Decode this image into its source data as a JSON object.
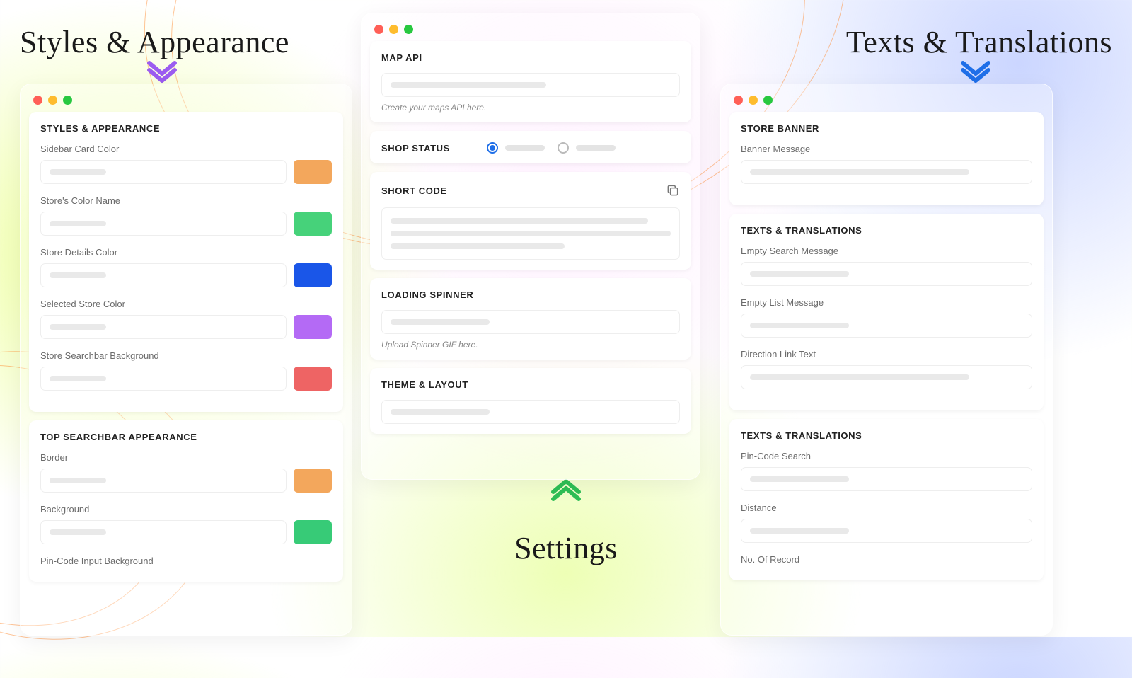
{
  "headings": {
    "styles": "Styles & Appearance",
    "texts": "Texts & Translations",
    "settings": "Settings"
  },
  "chevron_colors": {
    "styles": "#9b5cf0",
    "texts": "#1f6fe8",
    "settings": "#2fbf56"
  },
  "left": {
    "section1": {
      "title": "Styles & Appearance",
      "fields": [
        {
          "label": "Sidebar Card Color",
          "swatch": "#f3a75c"
        },
        {
          "label": "Store's Color Name",
          "swatch": "#46d27a"
        },
        {
          "label": "Store Details Color",
          "swatch": "#1a56e8"
        },
        {
          "label": "Selected Store Color",
          "swatch": "#b46af5"
        },
        {
          "label": "Store Searchbar Background",
          "swatch": "#ee6464"
        }
      ]
    },
    "section2": {
      "title": "Top Searchbar Appearance",
      "fields": [
        {
          "label": "Border",
          "swatch": "#f3a75c"
        },
        {
          "label": "Background",
          "swatch": "#37cb77"
        },
        {
          "label": "Pin-Code Input Background",
          "swatch": null
        }
      ]
    }
  },
  "mid": {
    "map_api": {
      "title": "Map API",
      "helper": "Create your maps API here."
    },
    "shop_status": {
      "title": "Shop Status",
      "selected_index": 0
    },
    "short_code": {
      "title": "Short Code"
    },
    "spinner": {
      "title": "Loading Spinner",
      "helper": "Upload Spinner GIF here."
    },
    "theme": {
      "title": "Theme & Layout"
    }
  },
  "right": {
    "banner": {
      "title": "Store Banner",
      "fields": [
        "Banner Message"
      ]
    },
    "tt1": {
      "title": "Texts & Translations",
      "fields": [
        "Empty Search Message",
        "Empty List Message",
        "Direction Link Text"
      ]
    },
    "tt2": {
      "title": "Texts & Translations",
      "fields": [
        "Pin-Code Search",
        "Distance",
        "No. Of Record"
      ]
    }
  }
}
